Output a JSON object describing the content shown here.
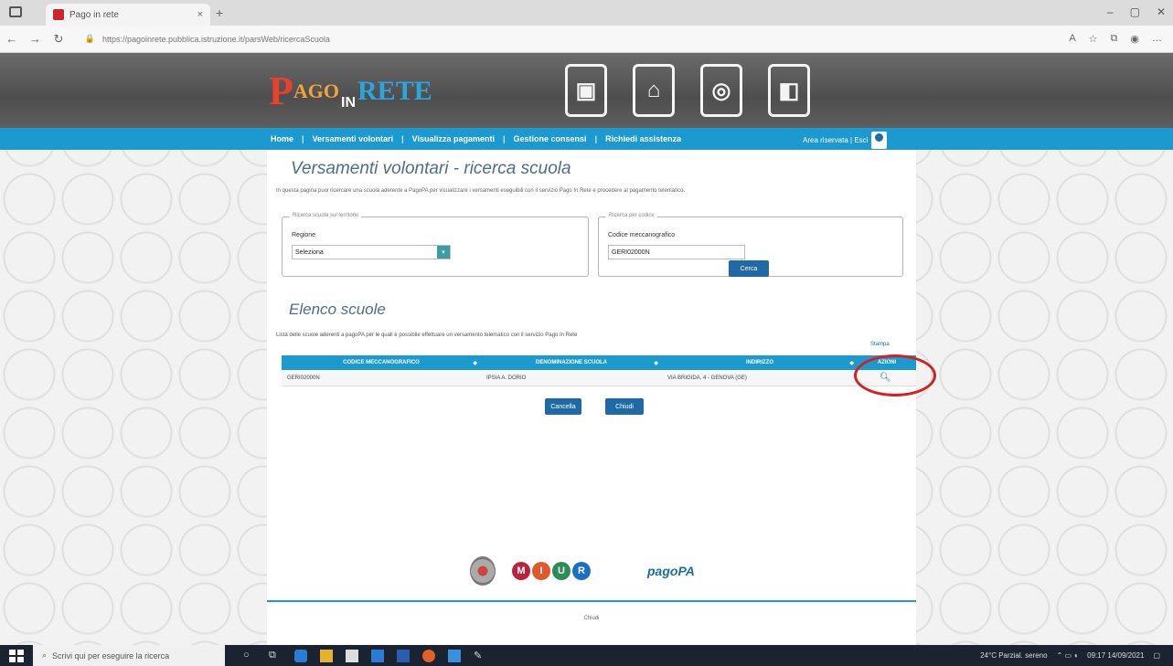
{
  "browser": {
    "tab_title": "Pago in rete",
    "tab_close": "×",
    "new_tab": "+",
    "url": "https://pagoinrete.pubblica.istruzione.it/parsWeb/ricercaScuola",
    "nav": {
      "back": "←",
      "forward": "→",
      "refresh": "↻"
    },
    "window": {
      "minimize": "–",
      "maximize": "▢",
      "close": "✕"
    }
  },
  "site": {
    "logo": {
      "p": "P",
      "ago": "AGO",
      "in": "IN",
      "rete": "RETE"
    },
    "banner_icons": [
      "bus-icon",
      "school-icon",
      "canteen-icon",
      "trip-icon"
    ],
    "nav_items": [
      "Home",
      "Versamenti volontari",
      "Visualizza pagamenti",
      "Gestione consensi",
      "Richiedi assistenza"
    ],
    "area_riservata": "Area riservata | Esci"
  },
  "main": {
    "title": "Versamenti volontari - ricerca scuola",
    "intro": "In questa pagina puoi ricercare una scuola aderente a PagoPA per visualizzare i versamenti eseguibili con il servizio Pago In Rete e procedere al pagamento telematico.",
    "search_region": {
      "legend": "Ricerca scuola sul territorio",
      "label": "Regione",
      "value": "Seleziona"
    },
    "search_code": {
      "legend": "Ricerca per codice",
      "label": "Codice meccanografico",
      "value": "GERI02000N",
      "button": "Cerca"
    },
    "list_title": "Elenco scuole",
    "list_desc": "Lista delle scuole aderenti a pagoPA per le quali è possibile effettuare un versamento telematico con il servizio Pago In Rete",
    "stampa": "Stampa",
    "table": {
      "headers": [
        "CODICE MECCANOGRAFICO",
        "DENOMINAZIONE SCUOLA",
        "INDIRIZZO",
        "AZIONI"
      ],
      "rows": [
        {
          "codice": "GERI02000N",
          "denominazione": "IPSIA A. DORIO",
          "indirizzo": "VIA BRIGIDA, 4 - GENOVA (GE)"
        }
      ]
    },
    "buttons": {
      "cancel": "Cancella",
      "close": "Chiudi"
    },
    "footer": "Chiudi",
    "logos": {
      "miur": [
        "M",
        "I",
        "U",
        "R"
      ],
      "pagopa": "pagoPA"
    }
  },
  "taskbar": {
    "search_placeholder": "Scrivi qui per eseguire la ricerca",
    "weather": "24°C Parzial. sereno",
    "time": "09:17",
    "date": "14/09/2021"
  },
  "colors": {
    "brand_blue": "#1c9ad0",
    "button_blue": "#1f6aa4",
    "annotation": "#d42020"
  }
}
